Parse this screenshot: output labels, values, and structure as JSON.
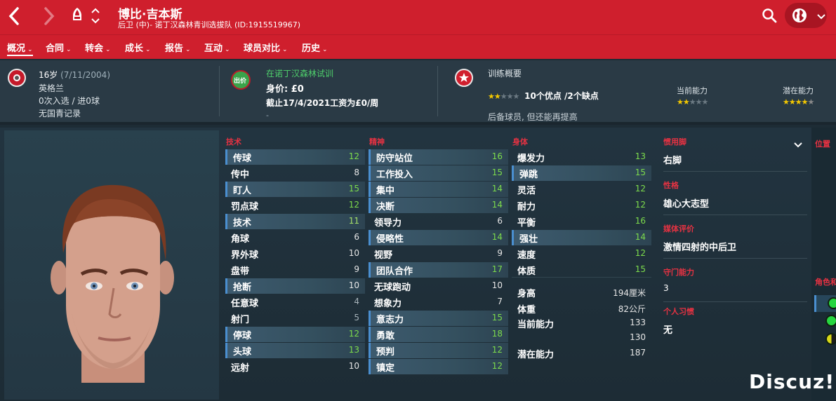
{
  "header": {
    "player_name": "博比·吉本斯",
    "player_sub": "后卫 (中)- 诺丁汉森林青训选拔队 (ID:1915519967)"
  },
  "tabs": [
    {
      "label": "概况"
    },
    {
      "label": "合同"
    },
    {
      "label": "转会"
    },
    {
      "label": "成长"
    },
    {
      "label": "报告"
    },
    {
      "label": "互动"
    },
    {
      "label": "球员对比"
    },
    {
      "label": "历史"
    }
  ],
  "info": {
    "age": "16岁",
    "dob": "(7/11/2004)",
    "nation": "英格兰",
    "caps": "0次入选 / 进0球",
    "youth_record": "无国青记录",
    "trial_status": "在诺丁汉森林试训",
    "badge_label": "出价",
    "value": "身价: £0",
    "contract": "截止17/4/2021工资为£0/周",
    "contract_dash": "-",
    "training_title": "训练概要",
    "training_stars": 2,
    "training_summary": "10个优点 /2个缺点",
    "training_note": "后备球员, 但还能再提高",
    "current_ability_label": "当前能力",
    "current_ability_stars": 2,
    "potential_ability_label": "潜在能力",
    "potential_ability_stars": 4
  },
  "attributes": {
    "technical_head": "技术",
    "mental_head": "精神",
    "physical_head": "身体",
    "technical": [
      {
        "label": "传球",
        "value": "12"
      },
      {
        "label": "传中",
        "value": "8"
      },
      {
        "label": "盯人",
        "value": "15"
      },
      {
        "label": "罚点球",
        "value": "12"
      },
      {
        "label": "技术",
        "value": "11"
      },
      {
        "label": "角球",
        "value": "6"
      },
      {
        "label": "界外球",
        "value": "10"
      },
      {
        "label": "盘带",
        "value": "9"
      },
      {
        "label": "抢断",
        "value": "10"
      },
      {
        "label": "任意球",
        "value": "4"
      },
      {
        "label": "射门",
        "value": "5"
      },
      {
        "label": "停球",
        "value": "12"
      },
      {
        "label": "头球",
        "value": "13"
      },
      {
        "label": "远射",
        "value": "10"
      }
    ],
    "mental": [
      {
        "label": "防守站位",
        "value": "16"
      },
      {
        "label": "工作投入",
        "value": "15"
      },
      {
        "label": "集中",
        "value": "14"
      },
      {
        "label": "决断",
        "value": "14"
      },
      {
        "label": "领导力",
        "value": "6"
      },
      {
        "label": "侵略性",
        "value": "14"
      },
      {
        "label": "视野",
        "value": "9"
      },
      {
        "label": "团队合作",
        "value": "17"
      },
      {
        "label": "无球跑动",
        "value": "10"
      },
      {
        "label": "想象力",
        "value": "7"
      },
      {
        "label": "意志力",
        "value": "15"
      },
      {
        "label": "勇敢",
        "value": "18"
      },
      {
        "label": "预判",
        "value": "12"
      },
      {
        "label": "镇定",
        "value": "12"
      }
    ],
    "physical": [
      {
        "label": "爆发力",
        "value": "13"
      },
      {
        "label": "弹跳",
        "value": "15"
      },
      {
        "label": "灵活",
        "value": "12"
      },
      {
        "label": "耐力",
        "value": "12"
      },
      {
        "label": "平衡",
        "value": "16"
      },
      {
        "label": "强壮",
        "value": "14"
      },
      {
        "label": "速度",
        "value": "12"
      },
      {
        "label": "体质",
        "value": "15"
      }
    ],
    "extra": [
      {
        "label": "身高",
        "value": "194厘米"
      },
      {
        "label": "体重",
        "value": "82公斤"
      },
      {
        "label": "当前能力",
        "value": "133"
      },
      {
        "label": "",
        "value": "130"
      },
      {
        "label": "潜在能力",
        "value": "187"
      }
    ]
  },
  "side": {
    "foot_head": "惯用脚",
    "foot_val": "右脚",
    "personality_head": "性格",
    "personality_val": "雄心大志型",
    "media_head": "媒体评价",
    "media_val": "激情四射的中后卫",
    "gk_head": "守门能力",
    "gk_val": "3",
    "habits_head": "个人习惯",
    "habits_val": "无",
    "position_head": "位置",
    "role_head": "角色和"
  },
  "watermark": "Discuz!",
  "colors": {
    "brand_red": "#cf1f2d",
    "good_green": "#7ddc4c",
    "highlight_blue": "#4a8fd0"
  }
}
